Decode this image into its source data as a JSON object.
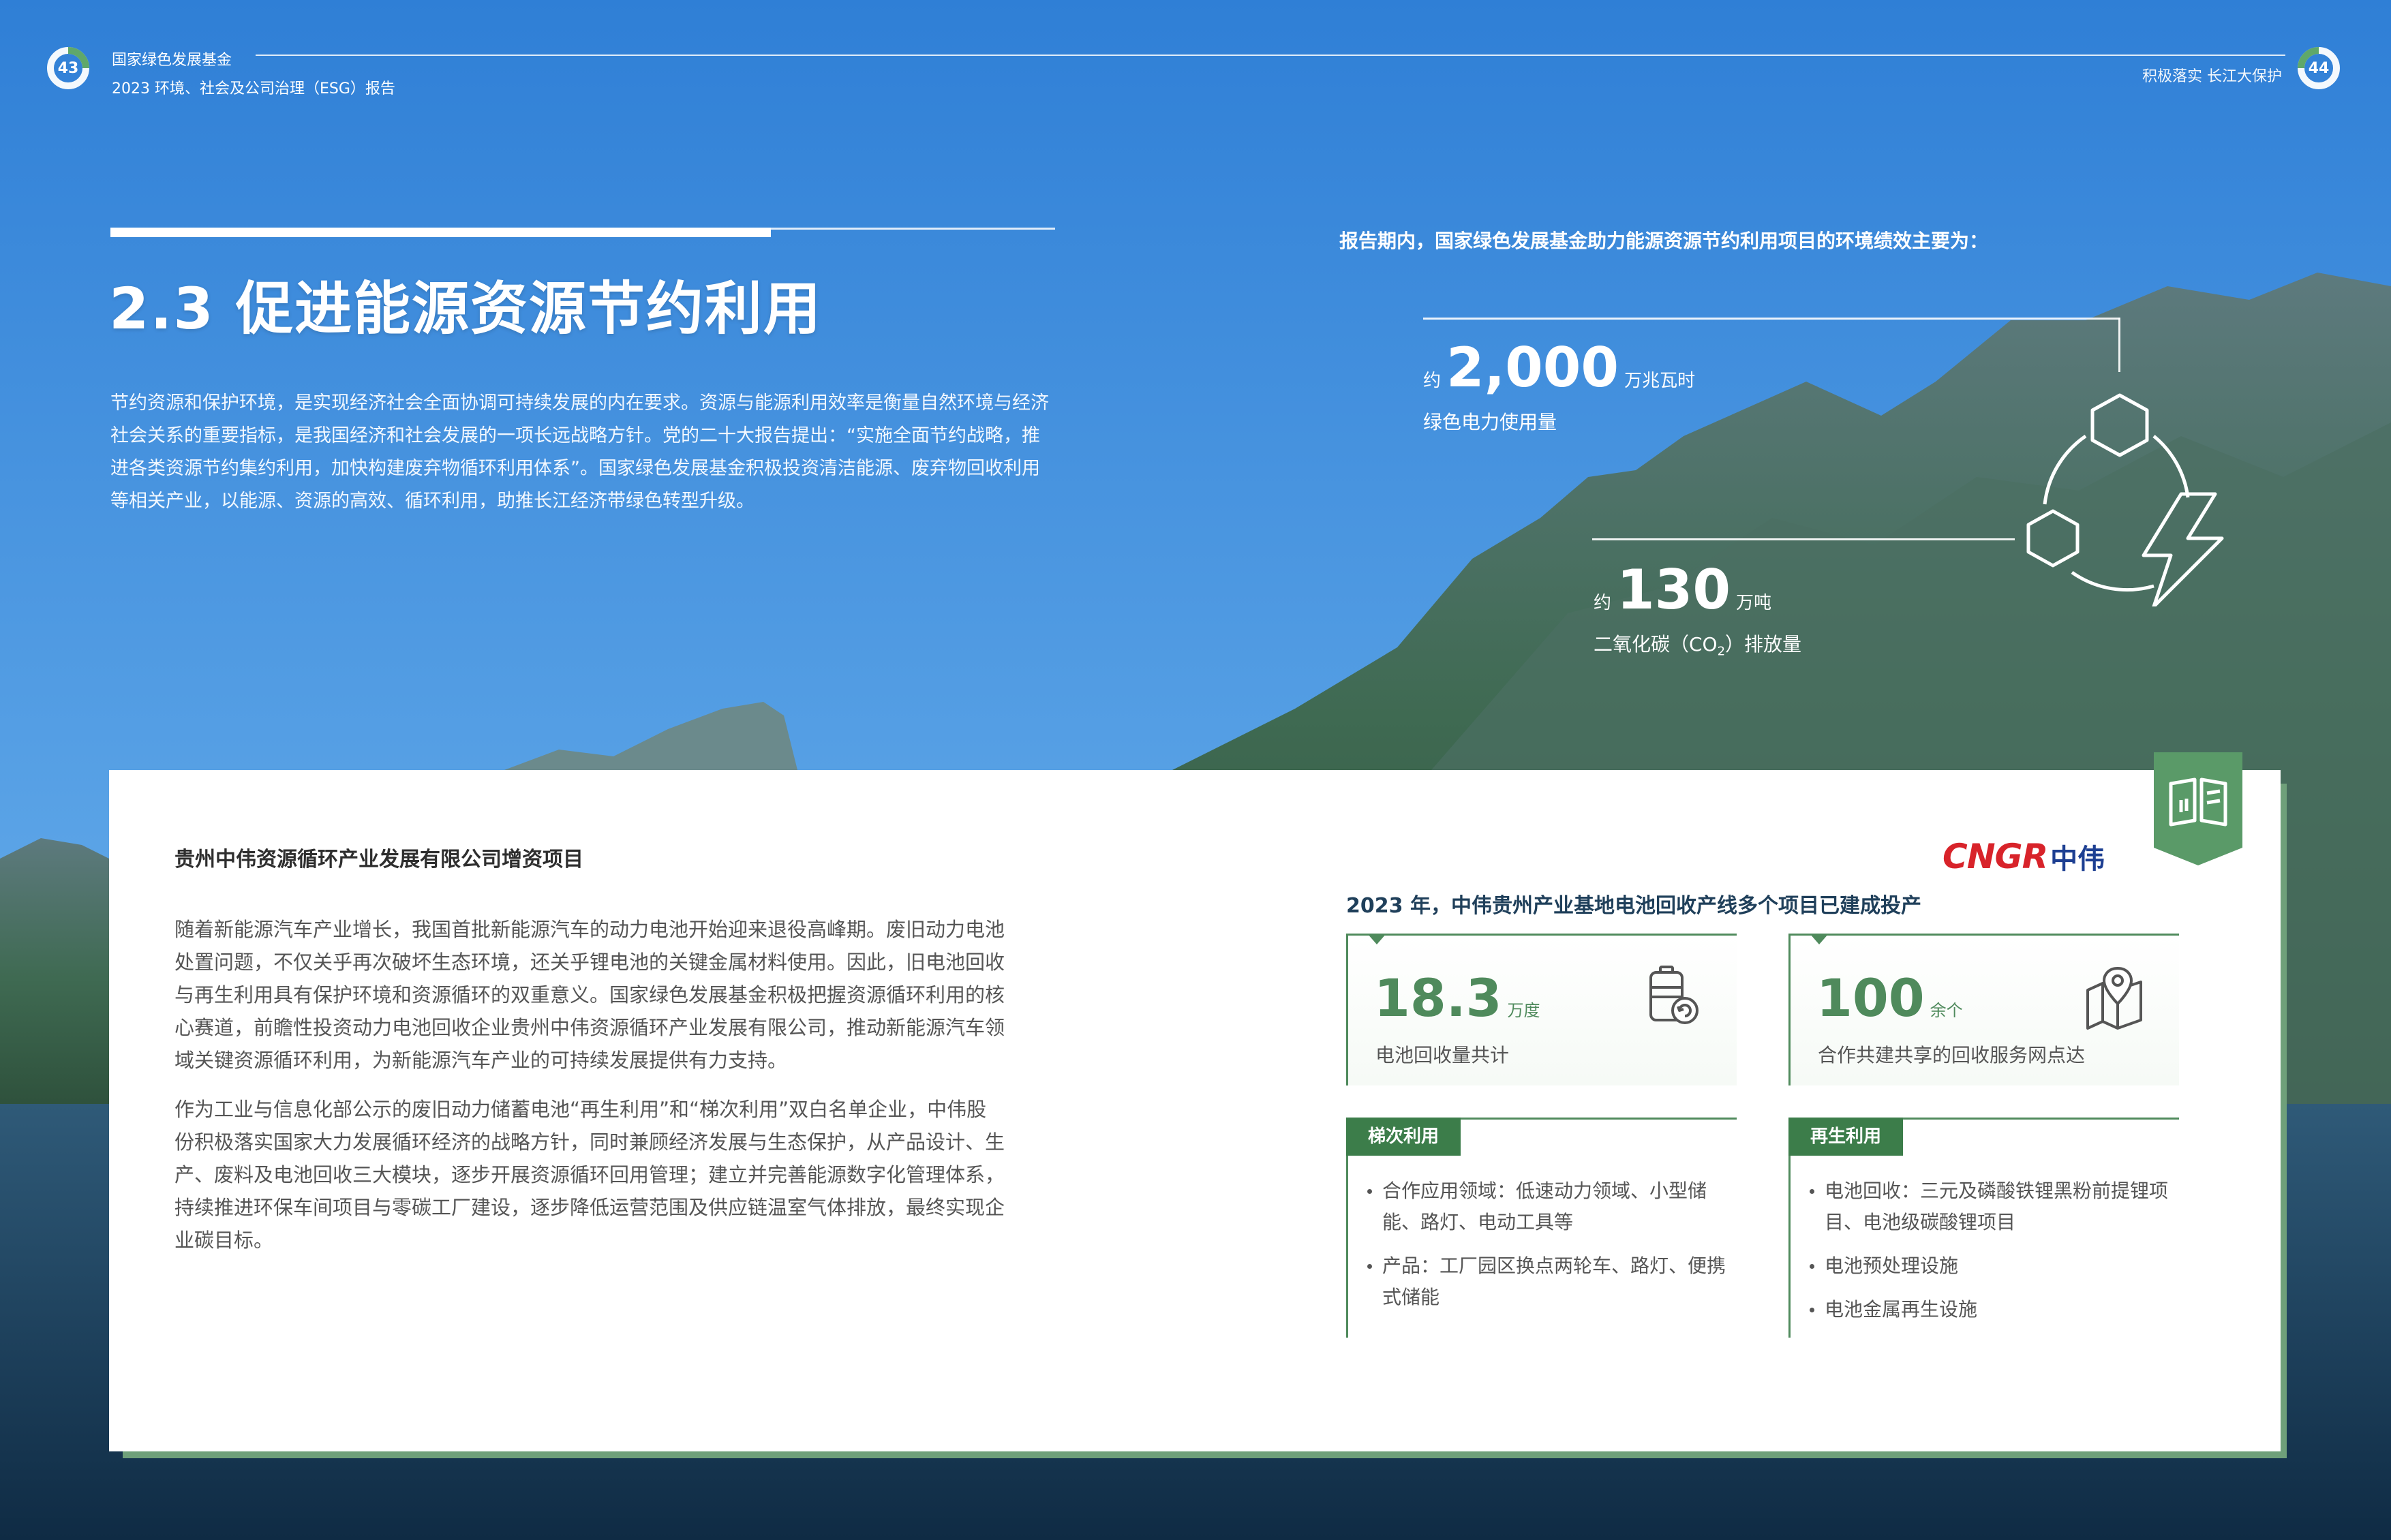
{
  "header": {
    "left_page": "43",
    "right_page": "44",
    "org_name": "国家绿色发展基金",
    "report_title": "2023  环境、社会及公司治理（ESG）报告",
    "section_tag": "积极落实 长江大保护"
  },
  "section": {
    "title": "2.3 促进能源资源节约利用",
    "intro": "节约资源和保护环境，是实现经济社会全面协调可持续发展的内在要求。资源与能源利用效率是衡量自然环境与经济社会关系的重要指标，是我国经济和社会发展的一项长远战略方针。党的二十大报告提出：“实施全面节约战略，推进各类资源节约集约利用，加快构建废弃物循环利用体系”。国家绿色发展基金积极投资清洁能源、废弃物回收利用等相关产业，以能源、资源的高效、循环利用，助推长江经济带绿色转型升级。"
  },
  "performance": {
    "caption": "报告期内，国家绿色发展基金助力能源资源节约利用项目的环境绩效主要为：",
    "stats": [
      {
        "prefix": "约",
        "value": "2,000",
        "unit": "万兆瓦时",
        "label": "绿色电力使用量"
      },
      {
        "prefix": "约",
        "value": "130",
        "unit": "万吨",
        "label_pre": "二氧化碳（CO",
        "label_sub": "2",
        "label_post": "）排放量"
      }
    ]
  },
  "case": {
    "title": "贵州中伟资源循环产业发展有限公司增资项目",
    "paragraphs": [
      "随着新能源汽车产业增长，我国首批新能源汽车的动力电池开始迎来退役高峰期。废旧动力电池处置问题，不仅关乎再次破坏生态环境，还关乎锂电池的关键金属材料使用。因此，旧电池回收与再生利用具有保护环境和资源循环的双重意义。国家绿色发展基金积极把握资源循环利用的核心赛道，前瞻性投资动力电池回收企业贵州中伟资源循环产业发展有限公司，推动新能源汽车领域关键资源循环利用，为新能源汽车产业的可持续发展提供有力支持。",
      "作为工业与信息化部公示的废旧动力储蓄电池“再生利用”和“梯次利用”双白名单企业，中伟股份积极落实国家大力发展循环经济的战略方针，同时兼顾经济发展与生态保护，从产品设计、生产、废料及电池回收三大模块，逐步开展资源循环回用管理；建立并完善能源数字化管理体系，持续推进环保车间项目与零碳工厂建设，逐步降低运营范围及供应链温室气体排放，最终实现企业碳目标。"
    ],
    "logo_en": "CNGR",
    "logo_cn": "中伟",
    "milestone": "2023 年，中伟贵州产业基地电池回收产线多个项目已建成投产",
    "metrics": [
      {
        "value": "18.3",
        "unit": "万度",
        "label": "电池回收量共计",
        "icon": "battery-recycle-icon"
      },
      {
        "value": "100",
        "unit": "余个",
        "label": "合作共建共享的回收服务网点达",
        "icon": "map-pin-icon"
      }
    ],
    "features": [
      {
        "tag": "梯次利用",
        "items": [
          "合作应用领域：低速动力领域、小型储能、路灯、电动工具等",
          "产品：工厂园区换点两轮车、路灯、便携式储能"
        ]
      },
      {
        "tag": "再生利用",
        "items": [
          "电池回收：三元及磷酸铁锂黑粉前提锂项目、电池级碳酸锂项目",
          "电池预处理设施",
          "电池金属再生设施"
        ]
      }
    ]
  },
  "colors": {
    "accent_green": "#4f8a5c",
    "tag_green": "#3c7d4a",
    "logo_red": "#d8232a",
    "logo_blue": "#1d3f92"
  }
}
